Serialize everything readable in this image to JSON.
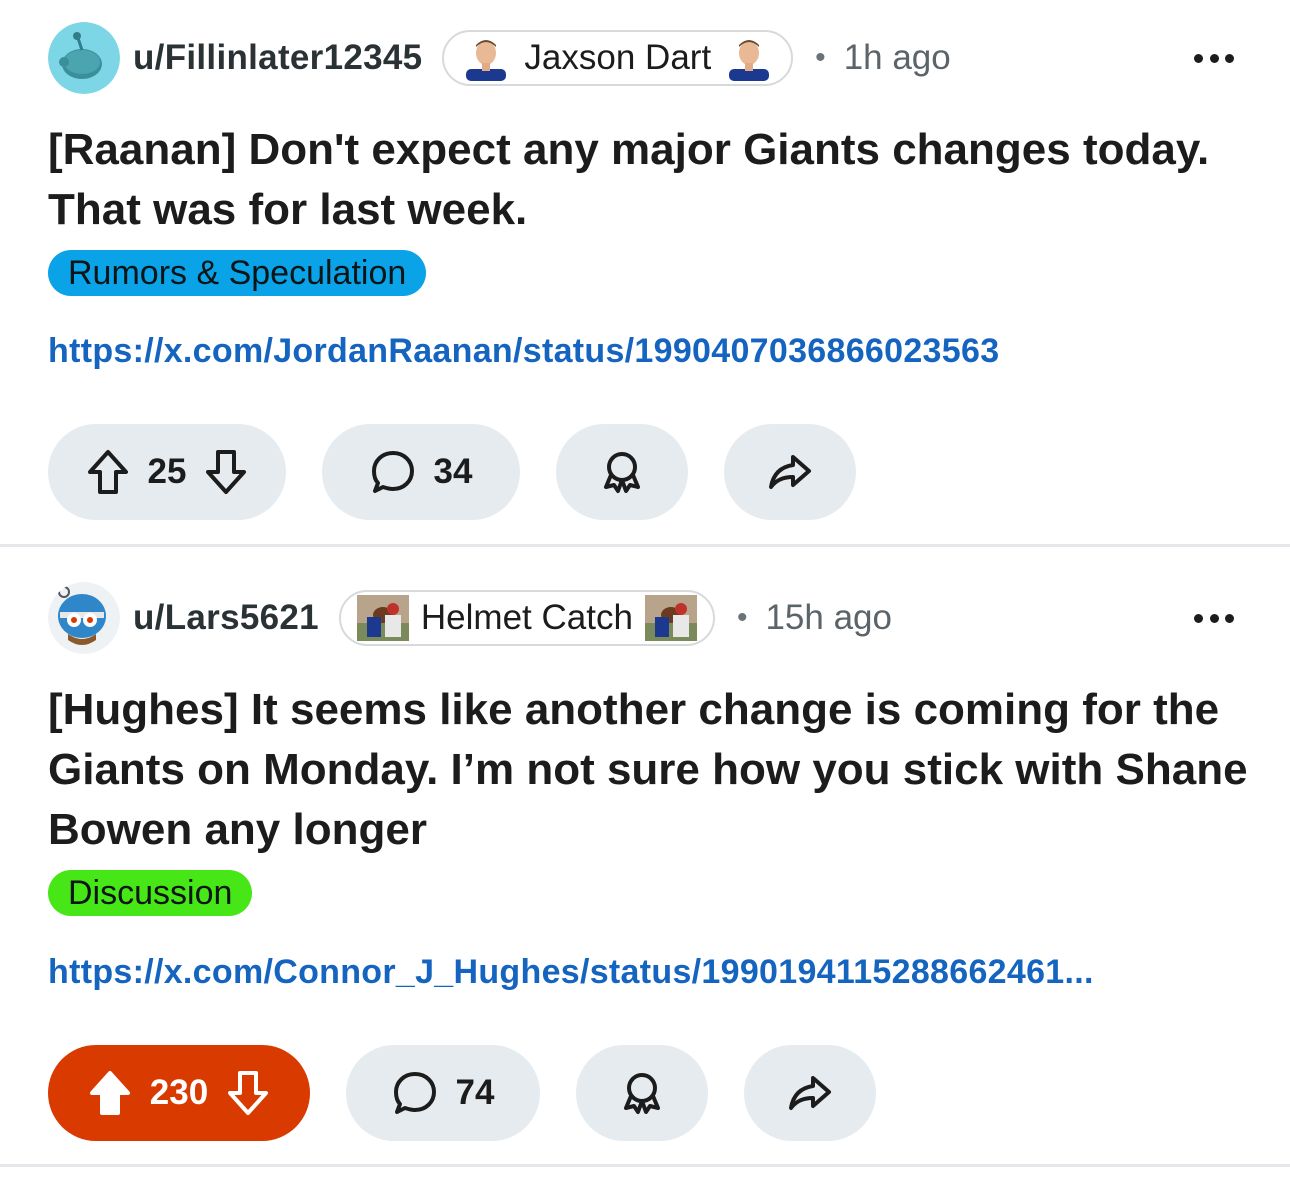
{
  "posts": [
    {
      "username": "u/Fillinlater12345",
      "flair": "Jaxson Dart",
      "time": "1h ago",
      "title": "[Raanan] Don't expect any major Giants changes today. That was for last week.",
      "tag": "Rumors & Speculation",
      "tag_color": "#0aa3e8",
      "link": "https://x.com/JordanRaanan/status/1990407036866023563",
      "votes": "25",
      "comments": "34",
      "upvoted": false
    },
    {
      "username": "u/Lars5621",
      "flair": "Helmet Catch",
      "time": "15h ago",
      "title": "[Hughes] It seems like another change is coming for the Giants on Monday. I’m not sure how you stick with Shane Bowen any longer",
      "tag": "Discussion",
      "tag_color": "#46e617",
      "link": "https://x.com/Connor_J_Hughes/status/1990194115288662461...",
      "votes": "230",
      "comments": "74",
      "upvoted": true
    }
  ],
  "icons": {
    "upvote": "arrow-up-icon",
    "downvote": "arrow-down-icon",
    "comment": "speech-bubble-icon",
    "award": "award-icon",
    "share": "share-arrow-icon",
    "more": "more-dots-icon"
  },
  "colors": {
    "upvote_active": "#d93a00",
    "pill_bg": "#e5ebee",
    "link": "#1565c0"
  }
}
